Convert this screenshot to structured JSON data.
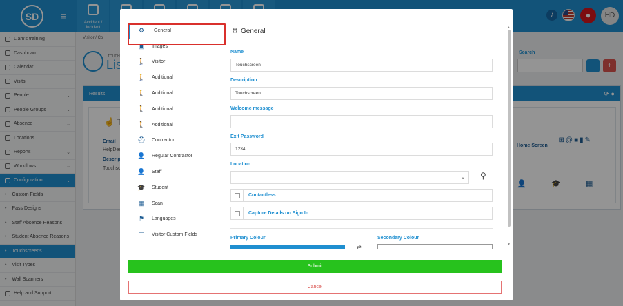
{
  "app": {
    "logo_text": "SD",
    "top_tiles": [
      {
        "line1": "Accident /",
        "line2": "Incident"
      },
      {
        "line1": "",
        "line2": ""
      },
      {
        "line1": "",
        "line2": ""
      },
      {
        "line1": "",
        "line2": ""
      },
      {
        "line1": "",
        "line2": ""
      },
      {
        "line1": "",
        "line2": ""
      }
    ],
    "avatar_initials": "HD"
  },
  "sidebar": {
    "items": [
      {
        "label": "Liam's training",
        "chev": false
      },
      {
        "label": "Dashboard",
        "chev": false
      },
      {
        "label": "Calendar",
        "chev": false
      },
      {
        "label": "Visits",
        "chev": false
      },
      {
        "label": "People",
        "chev": true
      },
      {
        "label": "People Groups",
        "chev": true
      },
      {
        "label": "Absence",
        "chev": true
      },
      {
        "label": "Locations",
        "chev": false
      },
      {
        "label": "Reports",
        "chev": true
      },
      {
        "label": "Workflows",
        "chev": true
      },
      {
        "label": "Configuration",
        "chev": true,
        "active": true
      },
      {
        "label": "Custom Fields",
        "sub": true
      },
      {
        "label": "Pass Designs",
        "sub": true
      },
      {
        "label": "Staff Absence Reasons",
        "sub": true
      },
      {
        "label": "Student Absence Reasons",
        "sub": true
      },
      {
        "label": "Touchscreens",
        "sub": true,
        "active": true
      },
      {
        "label": "Visit Types",
        "sub": true
      },
      {
        "label": "Wall Scanners",
        "sub": true
      },
      {
        "label": "Help and Support",
        "chev": false
      }
    ]
  },
  "background": {
    "breadcrumb": "Visitor  /  Co",
    "eyebrow": "TOUCH",
    "title": "Lis",
    "search_label": "Search",
    "results_label": "Results",
    "card_title": "To",
    "email_label": "Email",
    "email_value": "HelpDesk",
    "desc_label": "Descrip",
    "desc_value": "Touchsc",
    "home_screen_label": "Home Screen"
  },
  "modal": {
    "nav": [
      {
        "label": "General",
        "icon": "gears-icon",
        "glyph": "⚙",
        "active": true
      },
      {
        "label": "Images",
        "icon": "image-icon",
        "glyph": "▣"
      },
      {
        "label": "Visitor",
        "icon": "walking-person-icon",
        "glyph": "🚶"
      },
      {
        "label": "Additional",
        "icon": "walking-person-icon",
        "glyph": "🚶"
      },
      {
        "label": "Additional",
        "icon": "walking-person-icon",
        "glyph": "🚶"
      },
      {
        "label": "Additional",
        "icon": "walking-person-icon",
        "glyph": "🚶"
      },
      {
        "label": "Additional",
        "icon": "walking-person-icon",
        "glyph": "🚶"
      },
      {
        "label": "Contractor",
        "icon": "hard-hat-icon",
        "glyph": "⛑"
      },
      {
        "label": "Regular Contractor",
        "icon": "user-gear-icon",
        "glyph": "👤"
      },
      {
        "label": "Staff",
        "icon": "user-icon",
        "glyph": "👤"
      },
      {
        "label": "Student",
        "icon": "graduation-cap-icon",
        "glyph": "🎓"
      },
      {
        "label": "Scan",
        "icon": "qr-code-icon",
        "glyph": "▦"
      },
      {
        "label": "Languages",
        "icon": "flag-icon",
        "glyph": "⚑"
      },
      {
        "label": "Visitor Custom Fields",
        "icon": "list-check-icon",
        "glyph": "☰"
      }
    ],
    "form": {
      "title": "General",
      "name_label": "Name",
      "name_value": "Touchscreen",
      "description_label": "Description",
      "description_value": "Touchscreen",
      "welcome_label": "Welcome message",
      "welcome_value": "",
      "exit_password_label": "Exit Password",
      "exit_password_value": "1234",
      "location_label": "Location",
      "location_value": "",
      "contactless_label": "Contactless",
      "capture_label": "Capture Details on Sign In",
      "primary_colour_label": "Primary Colour",
      "secondary_colour_label": "Secondary Colour",
      "primary_colour": "#1f8fd0"
    },
    "submit_label": "Submit",
    "cancel_label": "Cancel"
  }
}
